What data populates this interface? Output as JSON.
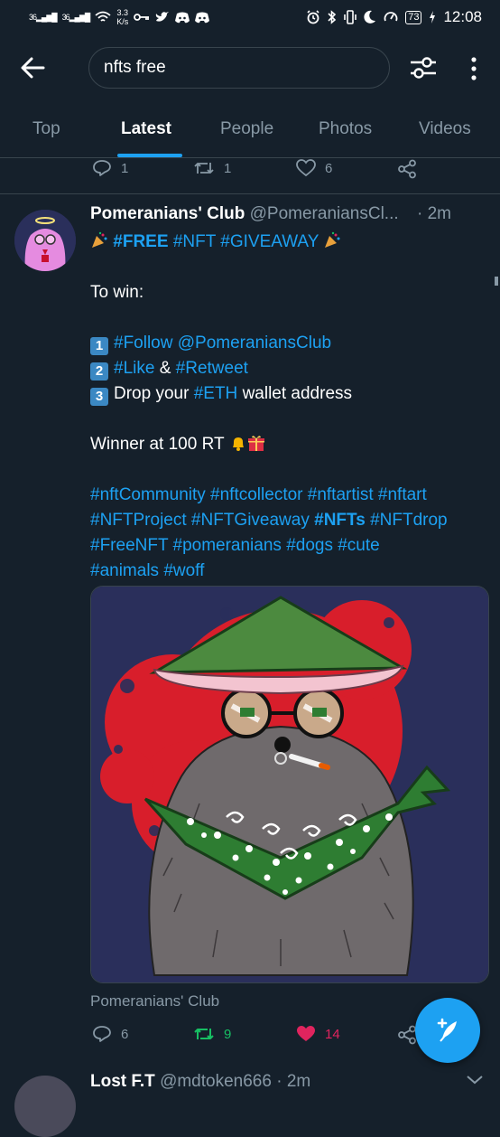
{
  "status_bar": {
    "signal1": "36",
    "signal2": "36",
    "speed_value": "3.3",
    "speed_unit": "K/s",
    "battery": "73",
    "time": "12:08"
  },
  "search": {
    "query": "nfts free"
  },
  "tabs": [
    {
      "label": "Top",
      "active": false
    },
    {
      "label": "Latest",
      "active": true
    },
    {
      "label": "People",
      "active": false
    },
    {
      "label": "Photos",
      "active": false
    },
    {
      "label": "Videos",
      "active": false
    }
  ],
  "prev_tweet": {
    "replies": "1",
    "retweets": "1",
    "likes": "6"
  },
  "tweet": {
    "name": "Pomeranians' Club",
    "handle": "@PomeraniansCl...",
    "separator": "·",
    "time": "2m",
    "line1_tags": [
      "#FREE",
      "#NFT",
      "#GIVEAWAY"
    ],
    "to_win": "To win:",
    "step1_tag": "#Follow",
    "step1_mention": "@PomeraniansClub",
    "step2_tag1": "#Like",
    "step2_amp": "&",
    "step2_tag2": "#Retweet",
    "step3_text1": "Drop your",
    "step3_tag": "#ETH",
    "step3_text2": "wallet address",
    "winner": "Winner at 100 RT",
    "tags_line1": "#nftCommunity #nftcollector #nftartist #nftart",
    "tags_line2a": "#NFTProject #NFTGiveaway",
    "tags_line2b": "#NFTs",
    "tags_line2c": "#NFTdrop",
    "tags_line3": "#FreeNFT #pomeranians #dogs #cute",
    "tags_line4": "#animals #woff",
    "caption": "Pomeranians' Club",
    "replies": "6",
    "retweets": "9",
    "likes": "14"
  },
  "next_tweet": {
    "name": "Lost F.T",
    "handle": "@mdtoken666",
    "separator": "·",
    "time": "2m"
  },
  "colors": {
    "background": "#15202b",
    "accent": "#1da1f2",
    "muted": "#8899a6",
    "retweet": "#17bf63",
    "like": "#e0245e"
  },
  "icons": {
    "back": "arrow-left-icon",
    "filter": "sliders-icon",
    "more": "vertical-dots-icon",
    "reply": "speech-bubble-icon",
    "retweet": "retweet-icon",
    "like": "heart-icon",
    "share": "share-icon",
    "compose": "feather-plus-icon"
  }
}
